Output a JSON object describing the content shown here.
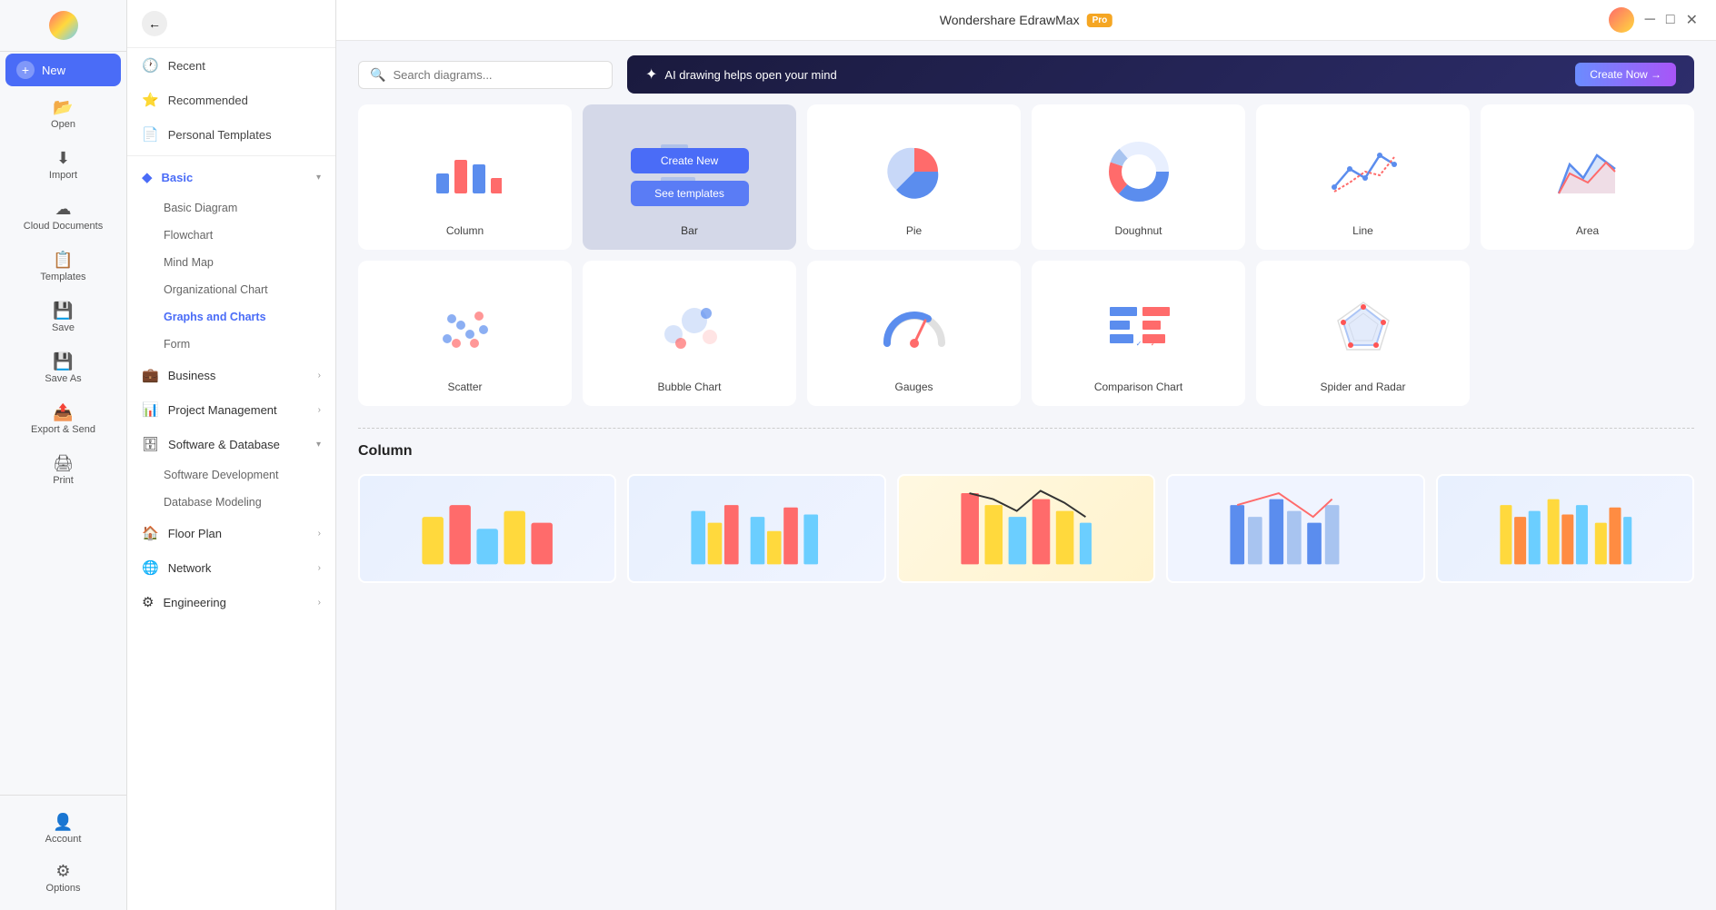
{
  "app": {
    "title": "Wondershare EdrawMax",
    "pro_badge": "Pro"
  },
  "topbar": {
    "right_icons": [
      "help-icon",
      "bell-icon",
      "apps-icon",
      "share-icon",
      "settings-icon"
    ],
    "avatar_label": "User Avatar"
  },
  "search": {
    "placeholder": "Search diagrams..."
  },
  "ai_bar": {
    "icon": "✦",
    "text": "AI drawing helps open your mind",
    "cta": "Create Now →"
  },
  "sidebar": {
    "items": [
      {
        "id": "new",
        "label": "New",
        "icon": "✦",
        "active": true
      },
      {
        "id": "open",
        "label": "Open",
        "icon": "📂"
      },
      {
        "id": "import",
        "label": "Import",
        "icon": "⬇"
      },
      {
        "id": "cloud",
        "label": "Cloud Documents",
        "icon": "☁"
      },
      {
        "id": "templates",
        "label": "Templates",
        "icon": "📋"
      },
      {
        "id": "save",
        "label": "Save",
        "icon": "💾"
      },
      {
        "id": "saveas",
        "label": "Save As",
        "icon": "💾"
      },
      {
        "id": "export",
        "label": "Export & Send",
        "icon": "📤"
      },
      {
        "id": "print",
        "label": "Print",
        "icon": "🖨"
      }
    ],
    "bottom": [
      {
        "id": "account",
        "label": "Account",
        "icon": "👤"
      },
      {
        "id": "options",
        "label": "Options",
        "icon": "⚙"
      }
    ]
  },
  "nav": {
    "top_items": [
      {
        "id": "recent",
        "label": "Recent",
        "icon": "🕐"
      },
      {
        "id": "recommended",
        "label": "Recommended",
        "icon": "⭐"
      },
      {
        "id": "personal",
        "label": "Personal Templates",
        "icon": "📄"
      }
    ],
    "categories": [
      {
        "id": "basic",
        "label": "Basic",
        "expanded": true,
        "icon": "◆",
        "active": true,
        "sub": [
          "Basic Diagram",
          "Flowchart",
          "Mind Map",
          "Organizational Chart",
          "Graphs and Charts",
          "Form"
        ]
      },
      {
        "id": "business",
        "label": "Business",
        "expanded": false,
        "icon": "💼",
        "sub": []
      },
      {
        "id": "pm",
        "label": "Project Management",
        "expanded": false,
        "icon": "📊",
        "sub": []
      },
      {
        "id": "software",
        "label": "Software & Database",
        "expanded": true,
        "icon": "🗄",
        "sub": [
          "Software Development",
          "Database Modeling"
        ]
      },
      {
        "id": "floorplan",
        "label": "Floor Plan",
        "expanded": false,
        "icon": "🏠",
        "sub": []
      },
      {
        "id": "network",
        "label": "Network",
        "expanded": false,
        "icon": "🌐",
        "sub": []
      },
      {
        "id": "engineering",
        "label": "Engineering",
        "expanded": false,
        "icon": "⚙",
        "sub": []
      }
    ]
  },
  "chart_types": [
    {
      "id": "column",
      "label": "Column",
      "selected": false
    },
    {
      "id": "bar",
      "label": "Bar",
      "selected": true
    },
    {
      "id": "pie",
      "label": "Pie",
      "selected": false
    },
    {
      "id": "doughnut",
      "label": "Doughnut",
      "selected": false
    },
    {
      "id": "line",
      "label": "Line",
      "selected": false
    },
    {
      "id": "area",
      "label": "Area",
      "selected": false
    },
    {
      "id": "scatter",
      "label": "Scatter",
      "selected": false
    },
    {
      "id": "bubble",
      "label": "Bubble Chart",
      "selected": false
    },
    {
      "id": "gauges",
      "label": "Gauges",
      "selected": false
    },
    {
      "id": "comparison",
      "label": "Comparison Chart",
      "selected": false
    },
    {
      "id": "spider",
      "label": "Spider and Radar",
      "selected": false
    }
  ],
  "overlay_buttons": {
    "create": "Create New",
    "templates": "See templates"
  },
  "templates_section": {
    "title": "Column",
    "items": [
      {
        "id": "t1"
      },
      {
        "id": "t2"
      },
      {
        "id": "t3"
      },
      {
        "id": "t4"
      },
      {
        "id": "t5"
      }
    ]
  }
}
